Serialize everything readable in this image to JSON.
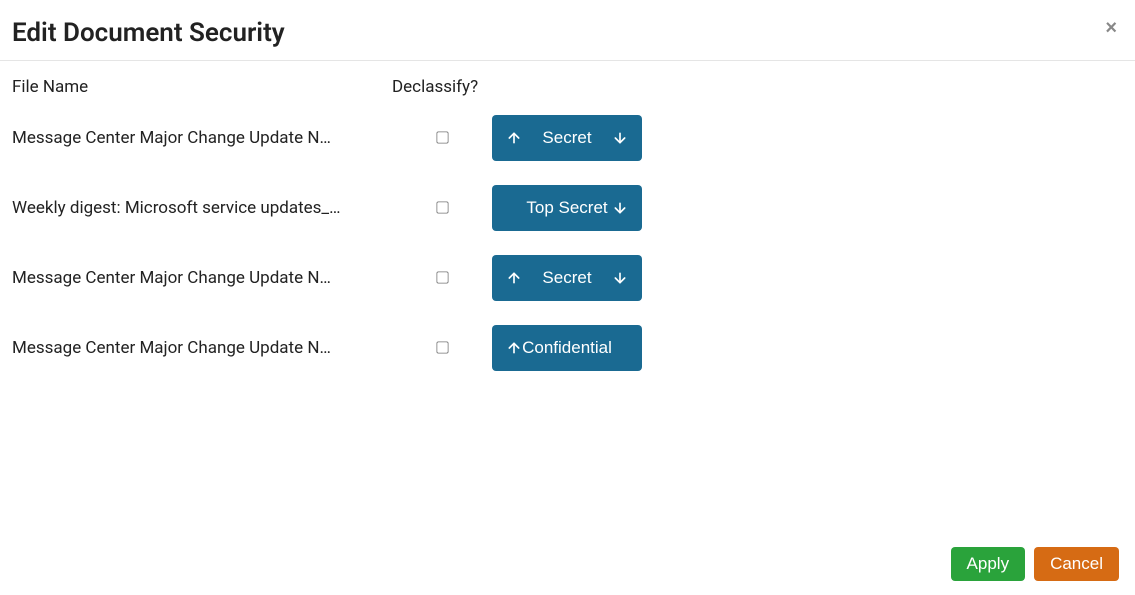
{
  "dialog": {
    "title": "Edit Document Security",
    "close_label": "×"
  },
  "headers": {
    "filename": "File Name",
    "declassify": "Declassify?"
  },
  "rows": [
    {
      "filename": "Message Center Major Change Update N…",
      "classification": "Secret",
      "show_up": true,
      "show_down": true
    },
    {
      "filename": "Weekly digest: Microsoft service updates_…",
      "classification": "Top Secret",
      "show_up": false,
      "show_down": true
    },
    {
      "filename": "Message Center Major Change Update N…",
      "classification": "Secret",
      "show_up": true,
      "show_down": true
    },
    {
      "filename": "Message Center Major Change Update N…",
      "classification": "Confidential",
      "show_up": true,
      "show_down": false
    }
  ],
  "footer": {
    "apply_label": "Apply",
    "cancel_label": "Cancel"
  }
}
